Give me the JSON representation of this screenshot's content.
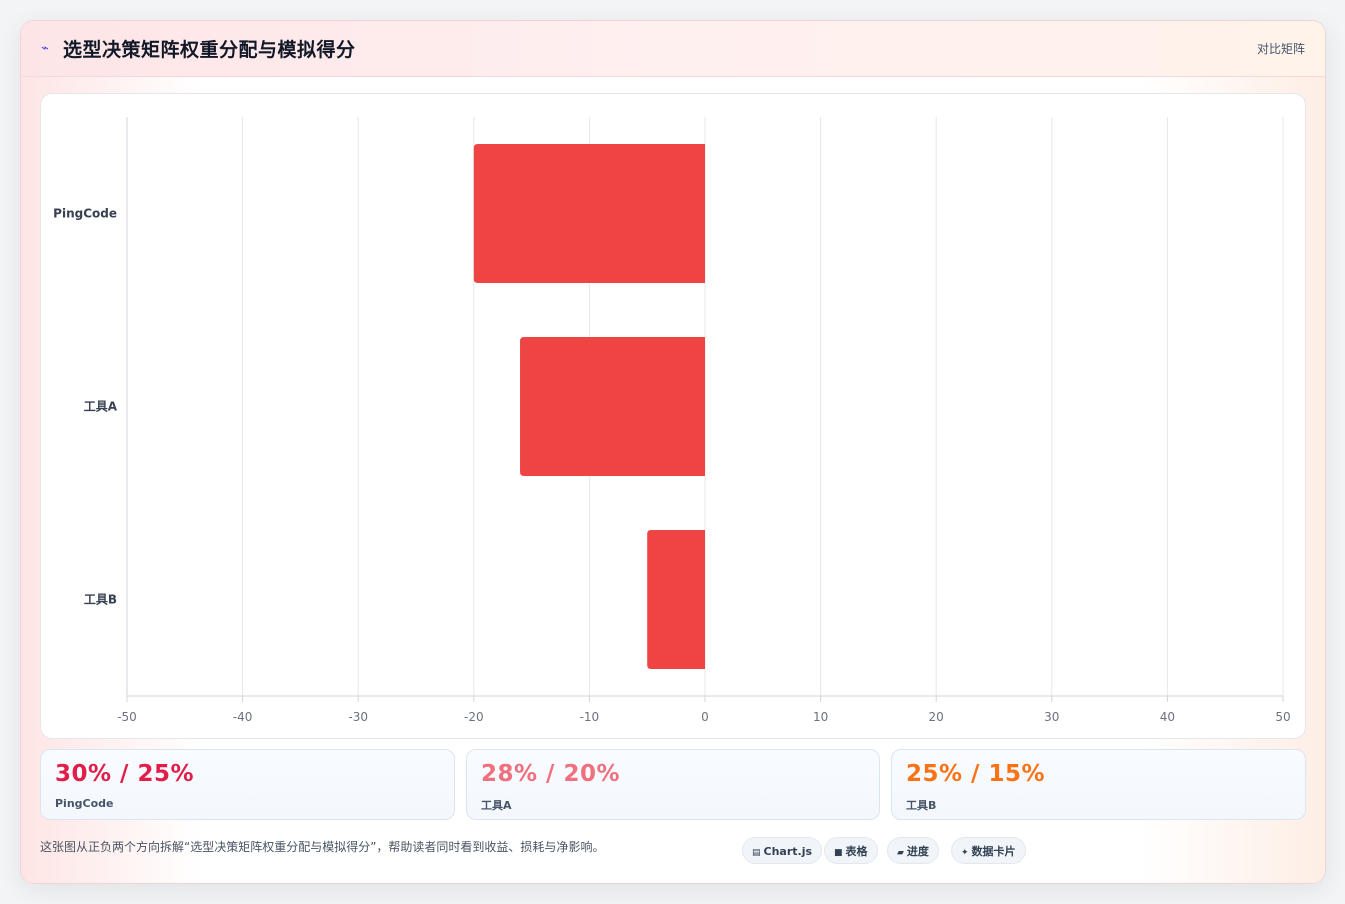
{
  "header": {
    "icon": "trend-icon",
    "title": "选型决策矩阵权重分配与模拟得分",
    "link_label": "对比矩阵"
  },
  "chart_data": {
    "type": "bar",
    "orientation": "horizontal",
    "categories": [
      "PingCode",
      "工具A",
      "工具B"
    ],
    "values": [
      -20,
      -16,
      -5
    ],
    "xlim": [
      -50,
      50
    ],
    "x_ticks": [
      "-50",
      "-40",
      "-30",
      "-20",
      "-10",
      "0",
      "10",
      "20",
      "30",
      "40",
      "50"
    ],
    "grid": true,
    "bar_color": "#ef4444"
  },
  "stats": [
    {
      "value": "30% / 25%",
      "label": "PingCode",
      "color": "#e11d48"
    },
    {
      "value": "28% / 20%",
      "label": "工具A",
      "color": "#f0707e"
    },
    {
      "value": "25% / 15%",
      "label": "工具B",
      "color": "#f97316"
    }
  ],
  "footer": {
    "note": "这张图从正负两个方向拆解“选型决策矩阵权重分配与模拟得分”，帮助读者同时看到收益、损耗与净影响。",
    "chips": [
      {
        "icon": "chart-icon",
        "glyph": "▤",
        "label": "Chart.js"
      },
      {
        "icon": "table-icon",
        "glyph": "■",
        "label": "表格"
      },
      {
        "icon": "progress-icon",
        "glyph": "▰",
        "label": "进度"
      },
      {
        "icon": "sparkle-icon",
        "glyph": "✦",
        "label": "数据卡片"
      }
    ]
  }
}
